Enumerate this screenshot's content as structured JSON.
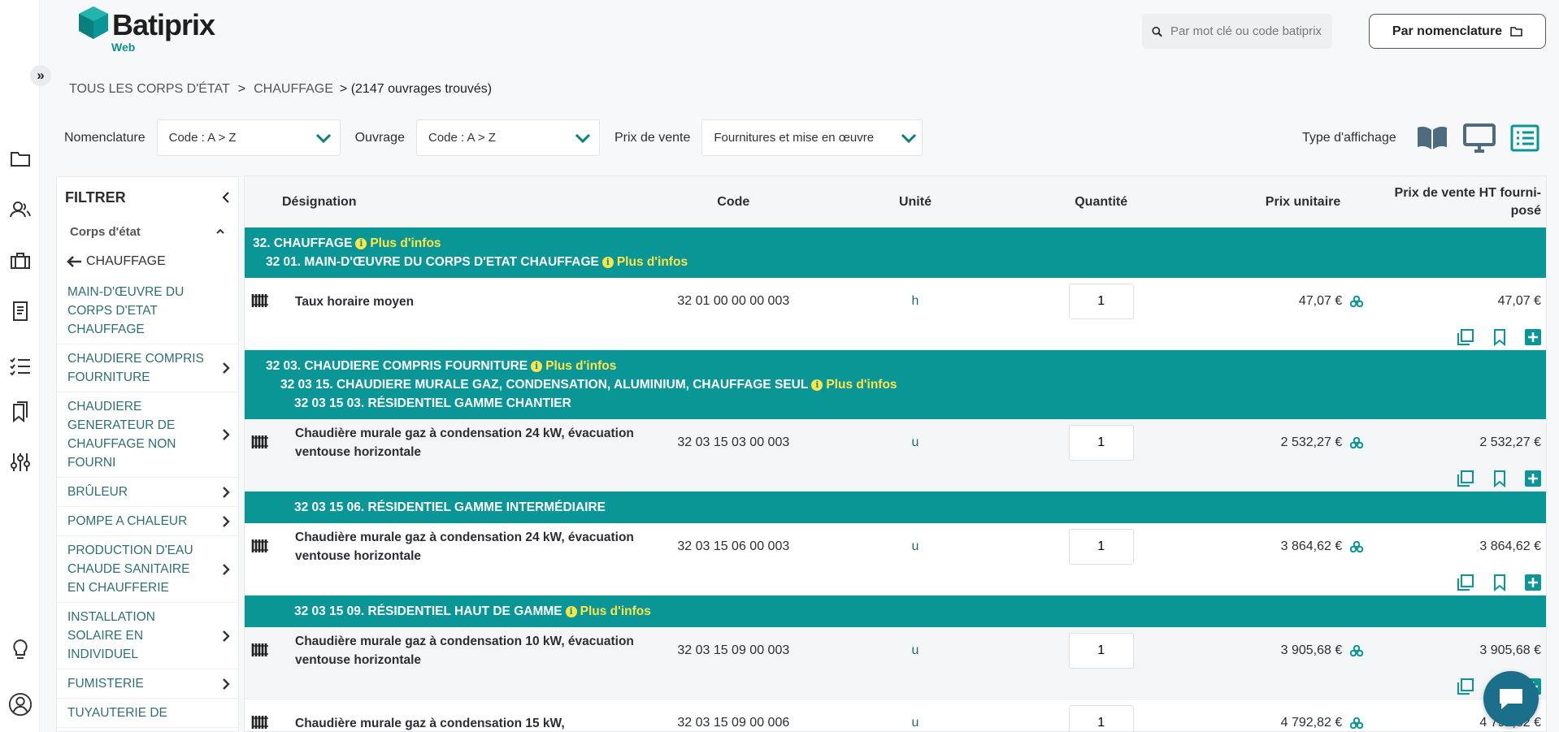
{
  "brand": {
    "name": "Batiprix",
    "sub": "Web",
    "accent": "#0a9696",
    "info_color": "#ffe54a"
  },
  "search": {
    "placeholder": "Par mot clé ou code batiprix"
  },
  "nomenclature_button": {
    "label": "Par nomenclature"
  },
  "breadcrumb": {
    "all": "TOUS LES CORPS D'ÉTAT",
    "sep": ">",
    "current": "CHAUFFAGE",
    "count": "> (2147 ouvrages trouvés)"
  },
  "sorting": {
    "nomenclature_label": "Nomenclature",
    "nomenclature_value": "Code : A > Z",
    "ouvrage_label": "Ouvrage",
    "ouvrage_value": "Code : A > Z",
    "prix_label": "Prix de vente",
    "prix_value": "Fournitures et mise en œuvre"
  },
  "view_type": {
    "label": "Type d'affichage",
    "icons": [
      "book-icon",
      "monitor-icon",
      "list-icon"
    ]
  },
  "filter": {
    "title": "FILTRER",
    "section": "Corps d'état",
    "back": "CHAUFFAGE",
    "items": [
      {
        "label": "MAIN-D'ŒUVRE DU CORPS D'ETAT CHAUFFAGE",
        "arrow": false
      },
      {
        "label": "CHAUDIERE COMPRIS FOURNITURE",
        "arrow": true
      },
      {
        "label": "CHAUDIERE GENERATEUR DE CHAUFFAGE NON FOURNI",
        "arrow": true
      },
      {
        "label": "BRÛLEUR",
        "arrow": true
      },
      {
        "label": "POMPE A CHALEUR",
        "arrow": true
      },
      {
        "label": "PRODUCTION D'EAU CHAUDE SANITAIRE EN CHAUFFERIE",
        "arrow": true
      },
      {
        "label": "INSTALLATION SOLAIRE EN INDIVIDUEL",
        "arrow": true
      },
      {
        "label": "FUMISTERIE",
        "arrow": true
      },
      {
        "label": "TUYAUTERIE DE",
        "arrow": false
      }
    ]
  },
  "table": {
    "headers": {
      "designation": "Désignation",
      "code": "Code",
      "unite": "Unité",
      "quantite": "Quantité",
      "prix_unitaire": "Prix unitaire",
      "prix_vente": "Prix de vente HT fourni-posé"
    },
    "info_label": "Plus d'infos",
    "group1": {
      "l1": "32. CHAUFFAGE",
      "l2": "32 01. MAIN-D'ŒUVRE DU CORPS D'ETAT CHAUFFAGE"
    },
    "group2": {
      "l1": "32 03. CHAUDIERE COMPRIS FOURNITURE",
      "l2": "32 03 15. CHAUDIERE MURALE GAZ, CONDENSATION, ALUMINIUM, CHAUFFAGE SEUL",
      "l3": "32 03 15 03. RÉSIDENTIEL GAMME CHANTIER"
    },
    "group3": {
      "l1": "32 03 15 06. RÉSIDENTIEL GAMME INTERMÉDIAIRE"
    },
    "group4": {
      "l1": "32 03 15 09. RÉSIDENTIEL HAUT DE GAMME"
    },
    "rows": [
      {
        "des": "Taux horaire moyen",
        "code": "32 01 00 00 00 003",
        "unit": "h",
        "qty": "1",
        "pu": "47,07 €",
        "pv": "47,07 €"
      },
      {
        "des": "Chaudière murale gaz à condensation 24 kW, évacuation ventouse horizontale",
        "code": "32 03 15 03 00 003",
        "unit": "u",
        "qty": "1",
        "pu": "2 532,27 €",
        "pv": "2 532,27 €"
      },
      {
        "des": "Chaudière murale gaz à condensation 24 kW, évacuation ventouse horizontale",
        "code": "32 03 15 06 00 003",
        "unit": "u",
        "qty": "1",
        "pu": "3 864,62 €",
        "pv": "3 864,62 €"
      },
      {
        "des": "Chaudière murale gaz à condensation 10 kW, évacuation ventouse horizontale",
        "code": "32 03 15 09 00 003",
        "unit": "u",
        "qty": "1",
        "pu": "3 905,68 €",
        "pv": "3 905,68 €"
      },
      {
        "des": "Chaudière murale gaz à condensation 15 kW,",
        "code": "32 03 15 09 00 006",
        "unit": "u",
        "qty": "1",
        "pu": "4 792,82 €",
        "pv": "4 792,82 €"
      }
    ]
  }
}
